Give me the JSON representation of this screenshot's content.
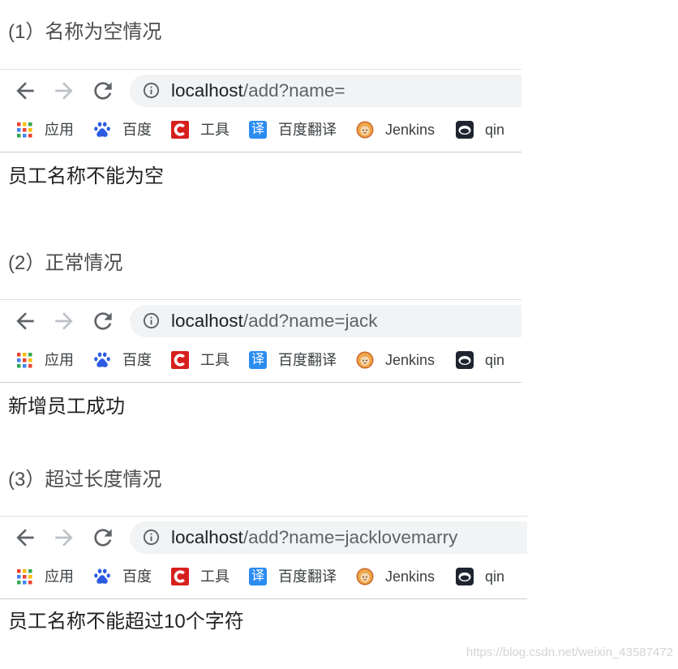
{
  "sections": [
    {
      "caption": "(1）名称为空情况",
      "browser": {
        "url_host": "localhost",
        "url_path": "/add?name="
      },
      "result": "员工名称不能为空"
    },
    {
      "caption": "(2）正常情况",
      "browser": {
        "url_host": "localhost",
        "url_path": "/add?name=jack"
      },
      "result": "新增员工成功"
    },
    {
      "caption": "(3）超过长度情况",
      "browser": {
        "url_host": "localhost",
        "url_path": "/add?name=jacklovemarry"
      },
      "result": "员工名称不能超过10个字符"
    }
  ],
  "toolbar_icons": {
    "back": "back-arrow-icon",
    "forward": "forward-arrow-icon",
    "reload": "reload-icon",
    "site_info": "info-icon"
  },
  "bookmarks": [
    {
      "label": "应用",
      "icon": "apps-grid-icon"
    },
    {
      "label": "百度",
      "icon": "baidu-paw-icon"
    },
    {
      "label": "工具",
      "icon": "red-c-logo-icon"
    },
    {
      "label": "百度翻译",
      "icon": "translate-icon",
      "icon_glyph": "译"
    },
    {
      "label": "Jenkins",
      "icon": "jenkins-icon"
    },
    {
      "label": "qin",
      "icon": "qin-icon"
    }
  ],
  "colors": {
    "caption": "#4d4d4d",
    "result": "#222222",
    "address_bar": "#f1f3f4",
    "url_host": "#202124",
    "url_path": "#5f6368",
    "nav_icon": "#5f6368",
    "nav_icon_disabled": "#bdc1c6",
    "bookmark_text": "#3c4043",
    "translate_blue": "#2b8cf0",
    "watermark": "#d4d4d4"
  },
  "watermark": "https://blog.csdn.net/weixin_43587472"
}
